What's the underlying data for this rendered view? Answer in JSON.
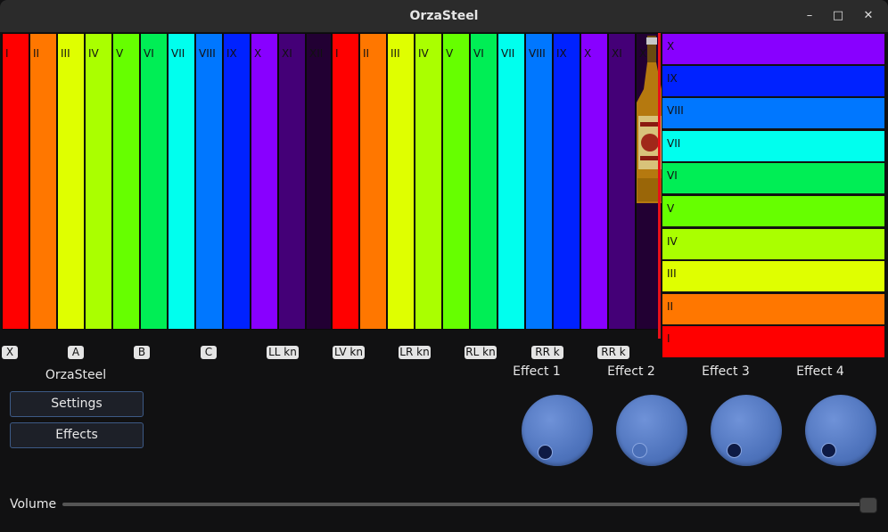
{
  "window": {
    "title": "OrzaSteel"
  },
  "colors": {
    "c1": "#ff0000",
    "c2": "#ff7700",
    "c3": "#dfff00",
    "c4": "#aaff00",
    "c5": "#66ff00",
    "c6": "#00ee55",
    "c7": "#00ffee",
    "c8": "#0077ff",
    "c9": "#0022ff",
    "c10": "#8800ff",
    "c11": "#440077",
    "c12": "#220033",
    "accent_red": "#e8101a"
  },
  "left_neck": {
    "labels": [
      "I",
      "II",
      "III",
      "IV",
      "V",
      "VI",
      "VII",
      "VIII",
      "IX",
      "X",
      "XI",
      "XII"
    ]
  },
  "mid_neck": {
    "labels": [
      "I",
      "II",
      "III",
      "IV",
      "V",
      "VI",
      "VII",
      "VIII",
      "IX",
      "X",
      "XI",
      "X"
    ]
  },
  "right_neck": {
    "labels": [
      "X",
      "IX",
      "VIII",
      "VII",
      "VI",
      "V",
      "IV",
      "III",
      "II",
      "I"
    ]
  },
  "keys": [
    "X",
    "A",
    "B",
    "C",
    "LL kn",
    "LV kn",
    "LR kn",
    "RL kn",
    "RR k",
    "RR k"
  ],
  "app_label": "OrzaSteel",
  "buttons": {
    "settings": "Settings",
    "effects": "Effects"
  },
  "effects": [
    "Effect 1",
    "Effect 2",
    "Effect 3",
    "Effect 4"
  ],
  "volume": {
    "label": "Volume",
    "value": 1.0
  }
}
